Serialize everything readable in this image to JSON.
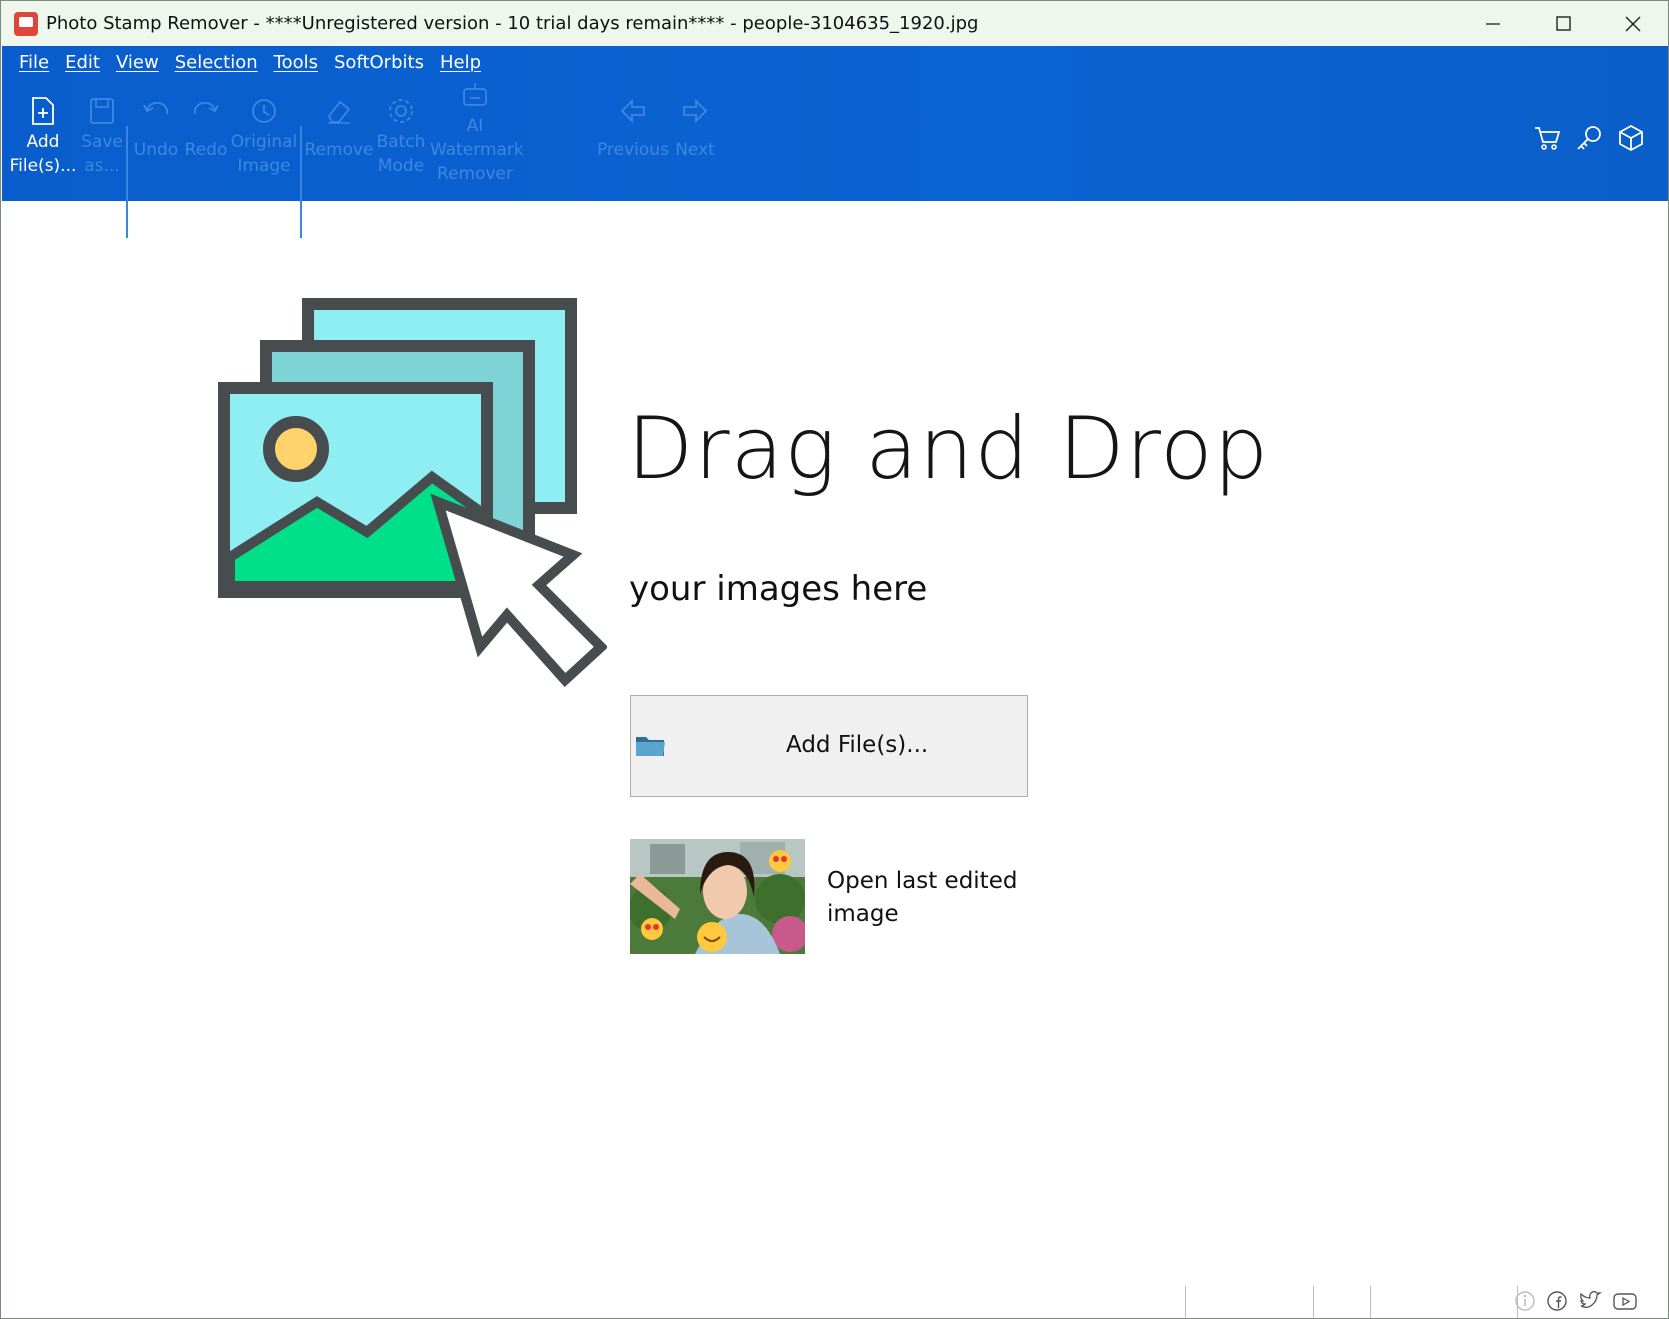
{
  "window": {
    "title": "Photo Stamp Remover - ****Unregistered version - 10 trial days remain**** - people-3104635_1920.jpg"
  },
  "menu": [
    "File",
    "Edit",
    "View",
    "Selection",
    "Tools",
    "SoftOrbits",
    "Help"
  ],
  "toolbar": {
    "add_files": [
      "Add",
      "File(s)..."
    ],
    "save_as": [
      "Save",
      "as..."
    ],
    "undo": "Undo",
    "redo": "Redo",
    "original_image": [
      "Original",
      "Image"
    ],
    "remove": "Remove",
    "batch_mode": [
      "Batch",
      "Mode"
    ],
    "ai_watermark": [
      "AI",
      "Watermark",
      "Remover"
    ],
    "previous": "Previous",
    "next": "Next",
    "right_icons": [
      "cart-icon",
      "key-icon",
      "package-icon"
    ]
  },
  "main": {
    "title": "Drag and Drop",
    "subtitle": "your images here",
    "add_button_label": "Add File(s)...",
    "last_edited_label": "Open last edited image"
  },
  "statusbar": {
    "icons": [
      "info-icon",
      "facebook-icon",
      "twitter-icon",
      "youtube-icon"
    ]
  },
  "colors": {
    "ribbon_blue": "#0b64d4",
    "disabled_text": "#3f87e0",
    "illustration_cyan": "#8eeef2",
    "illustration_green": "#00e08a",
    "illustration_sun": "#ffd36b",
    "illustration_frame": "#474d4f"
  }
}
